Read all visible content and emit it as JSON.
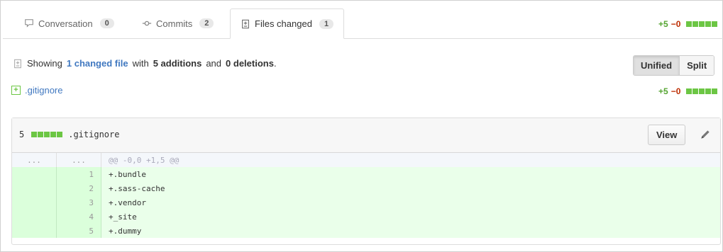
{
  "tabs": [
    {
      "label": "Conversation",
      "count": "0",
      "icon": "comment-icon"
    },
    {
      "label": "Commits",
      "count": "2",
      "icon": "commit-icon"
    },
    {
      "label": "Files changed",
      "count": "1",
      "icon": "diff-icon"
    }
  ],
  "summary_stats": {
    "additions": "+5",
    "deletions": "−0"
  },
  "toc": {
    "prefix": "Showing",
    "changed_files": "1 changed file",
    "mid1": "with",
    "additions_text": "5 additions",
    "mid2": "and",
    "deletions_text": "0 deletions",
    "suffix": "."
  },
  "view_mode": {
    "unified": "Unified",
    "split": "Split",
    "selected": "Unified"
  },
  "file_list": [
    {
      "name": ".gitignore",
      "additions": "+5",
      "deletions": "−0"
    }
  ],
  "file": {
    "change_count": "5",
    "name": ".gitignore",
    "view_label": "View",
    "hunk": {
      "left": "...",
      "right": "...",
      "header": "@@ -0,0 +1,5 @@"
    },
    "lines": [
      {
        "num": "1",
        "code": "+.bundle"
      },
      {
        "num": "2",
        "code": "+.sass-cache"
      },
      {
        "num": "3",
        "code": "+.vendor"
      },
      {
        "num": "4",
        "code": "+_site"
      },
      {
        "num": "5",
        "code": "+.dummy"
      }
    ]
  },
  "colors": {
    "addition": "#55a532",
    "deletion": "#bd2c00",
    "added_bg": "#eaffea",
    "link": "#4078c0"
  }
}
